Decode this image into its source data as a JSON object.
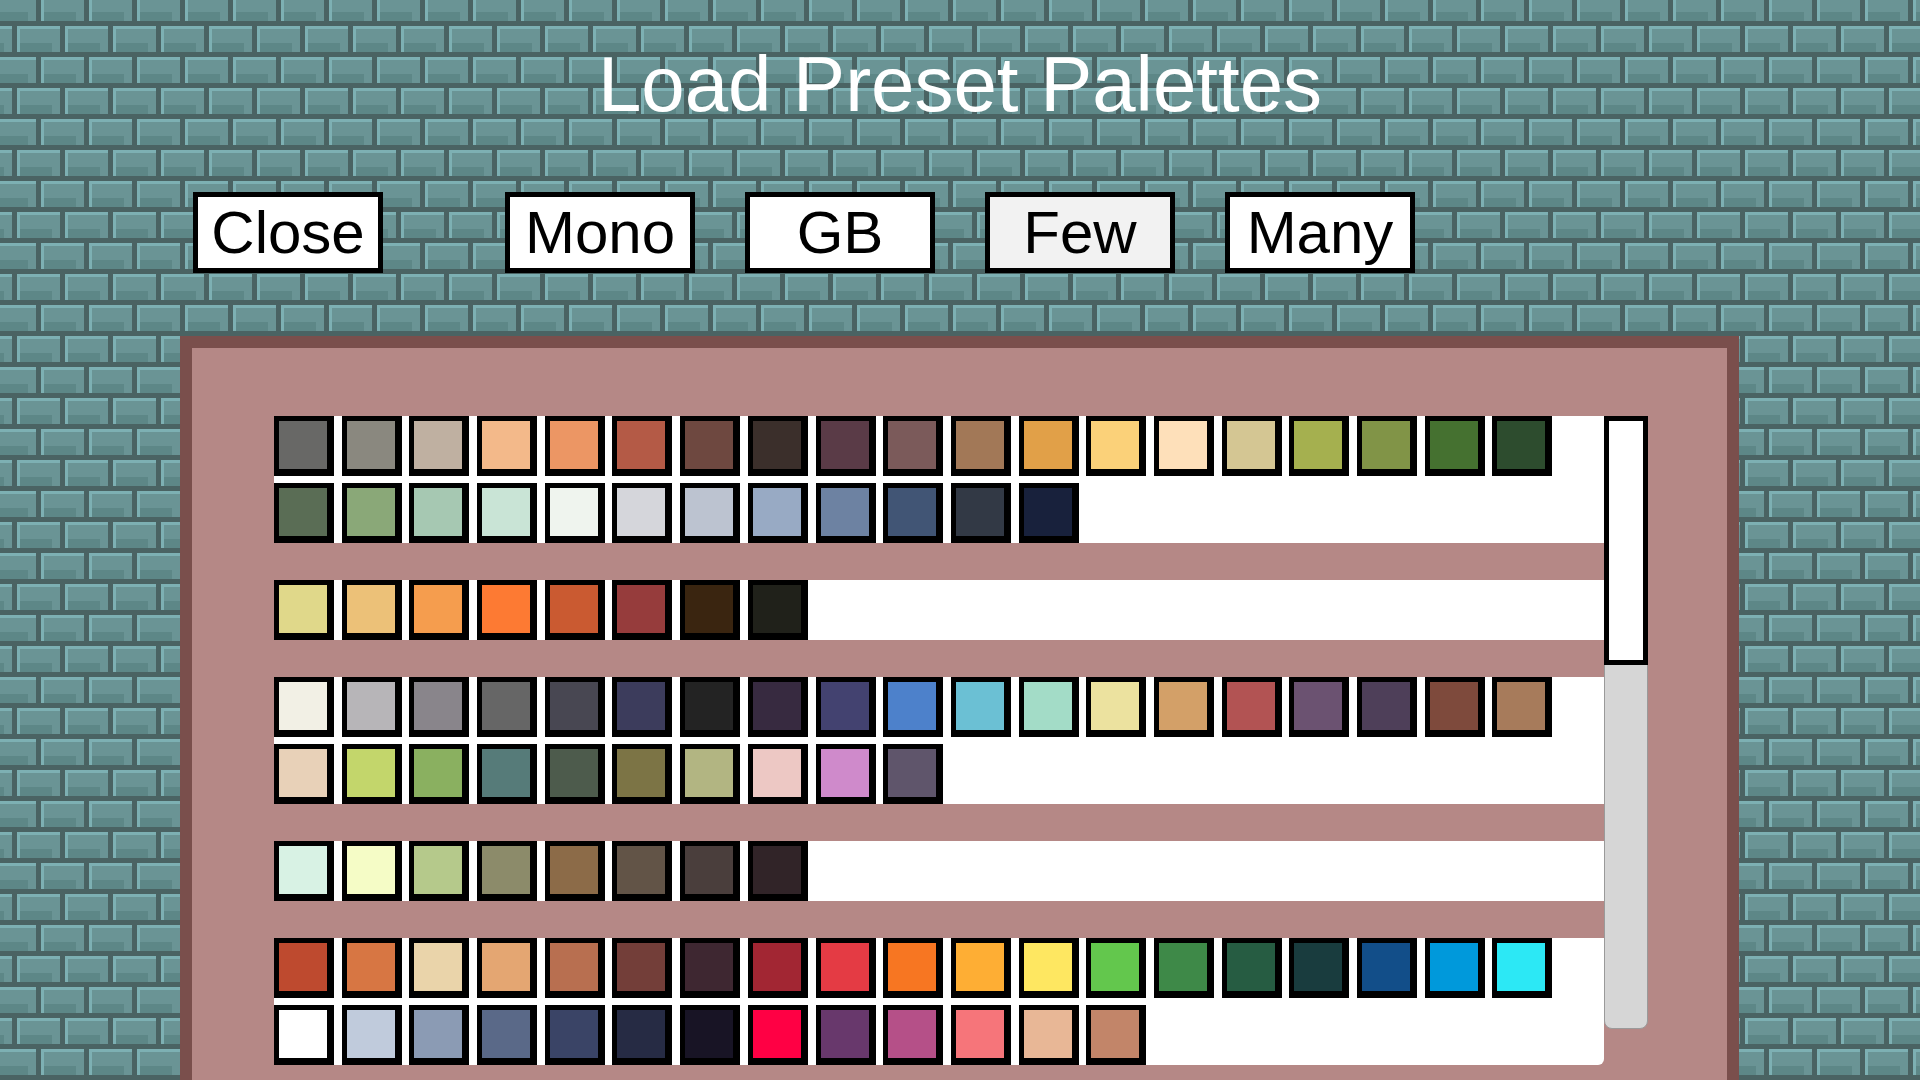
{
  "title": "Load Preset Palettes",
  "buttons": [
    {
      "label": "Close",
      "hovered": false
    },
    {
      "label": "Mono",
      "hovered": false
    },
    {
      "label": "GB",
      "hovered": false
    },
    {
      "label": "Few",
      "hovered": true
    },
    {
      "label": "Many",
      "hovered": false
    }
  ],
  "palettes": [
    {
      "swatches": [
        {
          "color": "#686866"
        },
        {
          "color": "#8a887f"
        },
        {
          "color": "#bfb0a1"
        },
        {
          "color": "#f3b98a"
        },
        {
          "color": "#ec9664"
        },
        {
          "color": "#b45a46"
        },
        {
          "color": "#6e4840"
        },
        {
          "color": "#3b2f2b"
        },
        {
          "color": "#5a3b47"
        },
        {
          "color": "#7b5a5a"
        },
        {
          "color": "#a27857"
        },
        {
          "color": "#e1a048"
        },
        {
          "color": "#fbd179"
        },
        {
          "color": "#fee0ba"
        },
        {
          "color": "#d4c693"
        },
        {
          "color": "#a5b04f"
        },
        {
          "color": "#819447"
        },
        {
          "color": "#457130"
        },
        {
          "color": "#2d4c2e"
        },
        {
          "color": "#5a6d55"
        },
        {
          "color": "#8aa878"
        },
        {
          "color": "#a6c8b2"
        },
        {
          "color": "#c9e4d6"
        },
        {
          "color": "#eff4ee"
        },
        {
          "color": "#d5d6db"
        },
        {
          "color": "#bcc3d0"
        },
        {
          "color": "#98aac4"
        },
        {
          "color": "#6d82a2"
        },
        {
          "color": "#415575"
        },
        {
          "color": "#323945"
        },
        {
          "color": "#18213c"
        }
      ]
    },
    {
      "swatches": [
        {
          "color": "#e0d88a"
        },
        {
          "color": "#ecc178"
        },
        {
          "color": "#f59d4e"
        },
        {
          "color": "#fd7a33"
        },
        {
          "color": "#ca5a31"
        },
        {
          "color": "#963c3c"
        },
        {
          "color": "#3a2510"
        },
        {
          "color": "#20211a"
        }
      ]
    },
    {
      "swatches": [
        {
          "color": "#f2f0e5"
        },
        {
          "color": "#b7b5b8"
        },
        {
          "color": "#89858b"
        },
        {
          "color": "#666666"
        },
        {
          "color": "#484752"
        },
        {
          "color": "#3c3c5c"
        },
        {
          "color": "#232323"
        },
        {
          "color": "#372a40"
        },
        {
          "color": "#434270"
        },
        {
          "color": "#4d81cb"
        },
        {
          "color": "#6bc0d4"
        },
        {
          "color": "#a3dcc7"
        },
        {
          "color": "#ece29f"
        },
        {
          "color": "#d3a068"
        },
        {
          "color": "#b25353"
        },
        {
          "color": "#6b5271"
        },
        {
          "color": "#4e3f59"
        },
        {
          "color": "#7e4a3c"
        },
        {
          "color": "#a77b5b"
        },
        {
          "color": "#e8d1b8"
        },
        {
          "color": "#c3d66b"
        },
        {
          "color": "#8ab060"
        },
        {
          "color": "#567b79"
        },
        {
          "color": "#4d5b4c"
        },
        {
          "color": "#7c7445"
        },
        {
          "color": "#b2b582"
        },
        {
          "color": "#edc8c4"
        },
        {
          "color": "#cf8acb"
        },
        {
          "color": "#5f556b"
        }
      ]
    },
    {
      "swatches": [
        {
          "color": "#d8f2e4"
        },
        {
          "color": "#f5fcc6"
        },
        {
          "color": "#b5c98b"
        },
        {
          "color": "#8c8b6a"
        },
        {
          "color": "#8c6b48"
        },
        {
          "color": "#625447"
        },
        {
          "color": "#4a3e3c"
        },
        {
          "color": "#312428"
        }
      ]
    },
    {
      "swatches": [
        {
          "color": "#be4a2f"
        },
        {
          "color": "#d77643"
        },
        {
          "color": "#ead4aa"
        },
        {
          "color": "#e4a672"
        },
        {
          "color": "#b86f50"
        },
        {
          "color": "#733e39"
        },
        {
          "color": "#3e2731"
        },
        {
          "color": "#a22633"
        },
        {
          "color": "#e43b44"
        },
        {
          "color": "#f77622"
        },
        {
          "color": "#feae34"
        },
        {
          "color": "#fee761"
        },
        {
          "color": "#63c74d"
        },
        {
          "color": "#3e8948"
        },
        {
          "color": "#265c42"
        },
        {
          "color": "#193c3e"
        },
        {
          "color": "#124e89"
        },
        {
          "color": "#0099db"
        },
        {
          "color": "#2ce8f5"
        },
        {
          "color": "#ffffff"
        },
        {
          "color": "#c0cbdc"
        },
        {
          "color": "#8b9bb4"
        },
        {
          "color": "#5a6988"
        },
        {
          "color": "#3a4466"
        },
        {
          "color": "#262b44"
        },
        {
          "color": "#181425"
        },
        {
          "color": "#ff0044"
        },
        {
          "color": "#68386c"
        },
        {
          "color": "#b55088"
        },
        {
          "color": "#f6757a"
        },
        {
          "color": "#e8b796"
        },
        {
          "color": "#c28569"
        }
      ]
    }
  ]
}
